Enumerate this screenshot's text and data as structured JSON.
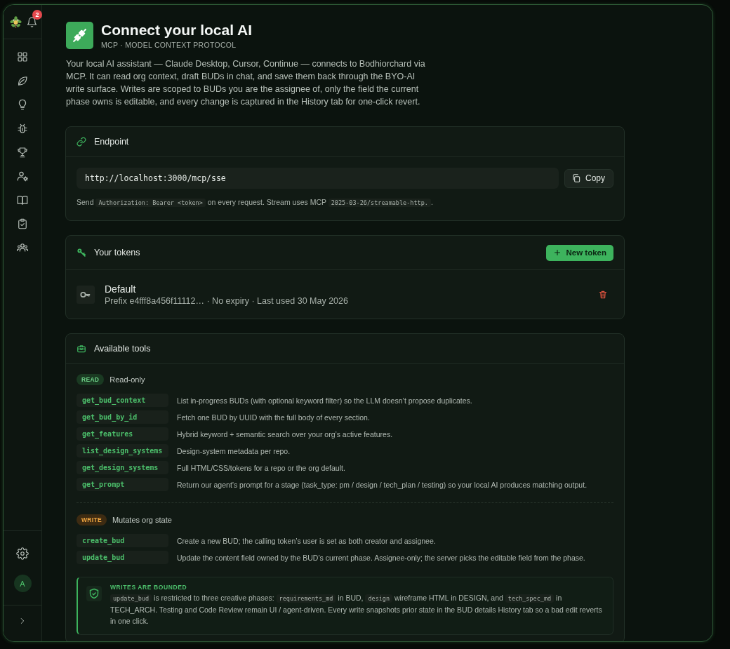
{
  "sidebar": {
    "notification_count": "2",
    "nav_items": [
      {
        "kind": "grid",
        "selected": false
      },
      {
        "kind": "leaf",
        "selected": false
      },
      {
        "kind": "bulb",
        "selected": false
      },
      {
        "kind": "bug",
        "selected": false
      },
      {
        "kind": "trophy",
        "selected": false
      },
      {
        "kind": "user-gear",
        "selected": false
      },
      {
        "kind": "book",
        "selected": false
      },
      {
        "kind": "clipboard",
        "selected": false
      },
      {
        "kind": "team",
        "selected": false
      }
    ],
    "avatar_initial": "A"
  },
  "header": {
    "title": "Connect your local AI",
    "subtitle": "MCP · MODEL CONTEXT PROTOCOL",
    "description": "Your local AI assistant — Claude Desktop, Cursor, Continue — connects to Bodhiorchard via MCP. It can read org context, draft BUDs in chat, and save them back through the BYO-AI write surface. Writes are scoped to BUDs you are the assignee of, only the field the current phase owns is editable, and every change is captured in the History tab for one-click revert."
  },
  "endpoint": {
    "title": "Endpoint",
    "url": "http://localhost:3000/mcp/sse",
    "copy_button": "Copy",
    "note": [
      {
        "kind": "text",
        "text": "Send "
      },
      {
        "kind": "code",
        "text": "Authorization: Bearer <token>"
      },
      {
        "kind": "text",
        "text": " on every request. Stream uses MCP "
      },
      {
        "kind": "code",
        "text": "2025-03-26/streamable-http."
      },
      {
        "kind": "text",
        "text": "."
      }
    ]
  },
  "tokens": {
    "title": "Your tokens",
    "new_button": "New token",
    "items": [
      {
        "name": "Default",
        "meta": "Prefix e4fff8a456f11112… · No expiry · Last used 30 May 2026"
      }
    ]
  },
  "tools": {
    "title": "Available tools",
    "groups": [
      {
        "kind": "read",
        "badge": "READ",
        "label": "Read-only",
        "tools": [
          {
            "name": "get_bud_context",
            "description": "List in-progress BUDs (with optional keyword filter) so the LLM doesn’t propose duplicates."
          },
          {
            "name": "get_bud_by_id",
            "description": "Fetch one BUD by UUID with the full body of every section."
          },
          {
            "name": "get_features",
            "description": "Hybrid keyword + semantic search over your org’s active features."
          },
          {
            "name": "list_design_systems",
            "description": "Design-system metadata per repo."
          },
          {
            "name": "get_design_systems",
            "description": "Full HTML/CSS/tokens for a repo or the org default."
          },
          {
            "name": "get_prompt",
            "description": "Return our agent’s prompt for a stage (task_type: pm / design / tech_plan / testing) so your local AI produces matching output."
          }
        ]
      },
      {
        "kind": "write",
        "badge": "WRITE",
        "label": "Mutates org state",
        "tools": [
          {
            "name": "create_bud",
            "description": "Create a new BUD; the calling token’s user is set as both creator and assignee."
          },
          {
            "name": "update_bud",
            "description": "Update the content field owned by the BUD’s current phase. Assignee-only; the server picks the editable field from the phase."
          }
        ]
      }
    ],
    "callout": {
      "title": "WRITES ARE BOUNDED",
      "text": [
        {
          "kind": "code",
          "text": "update_bud"
        },
        {
          "kind": "text",
          "text": " is restricted to three creative phases: "
        },
        {
          "kind": "code",
          "text": "requirements_md"
        },
        {
          "kind": "text",
          "text": " in BUD, "
        },
        {
          "kind": "code",
          "text": "design"
        },
        {
          "kind": "text",
          "text": " wireframe HTML in DESIGN, and "
        },
        {
          "kind": "code",
          "text": "tech_spec_md"
        },
        {
          "kind": "text",
          "text": " in TECH_ARCH. Testing and Code Review remain UI / agent-driven. Every write snapshots prior state in the BUD details History tab so a bad edit reverts in one click."
        }
      ]
    }
  }
}
